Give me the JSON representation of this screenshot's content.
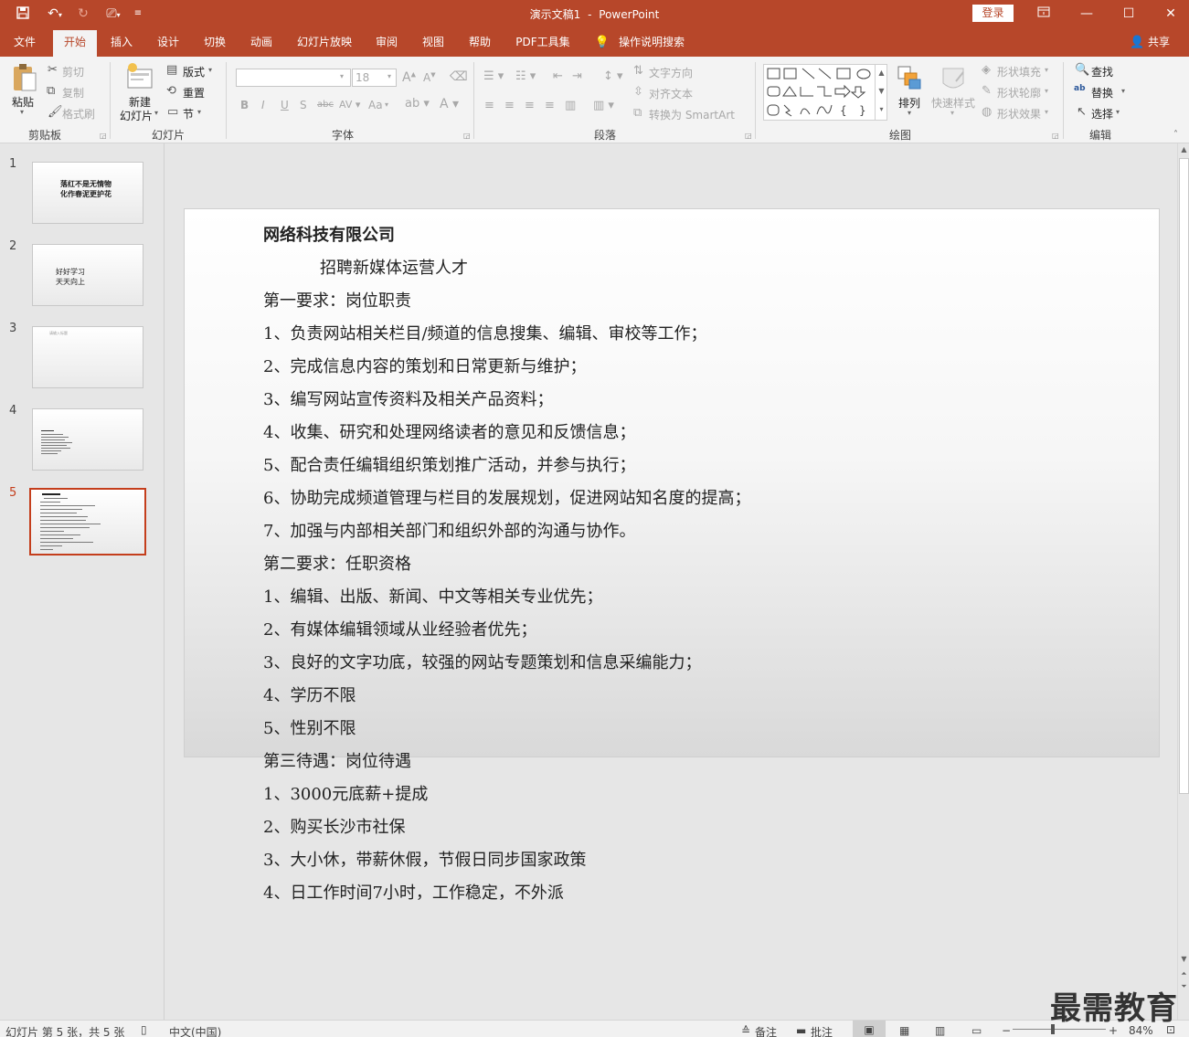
{
  "titlebar": {
    "doc_title": "演示文稿1",
    "separator": "-",
    "app_name": "PowerPoint",
    "login": "登录"
  },
  "tabs": [
    "文件",
    "开始",
    "插入",
    "设计",
    "切换",
    "动画",
    "幻灯片放映",
    "审阅",
    "视图",
    "帮助",
    "PDF工具集",
    "操作说明搜索"
  ],
  "share": "共享",
  "ribbon": {
    "clipboard": {
      "paste": "粘贴",
      "cut": "剪切",
      "copy": "复制",
      "format_painter": "格式刷",
      "group": "剪贴板"
    },
    "slides": {
      "new_slide_l1": "新建",
      "new_slide_l2": "幻灯片",
      "layout": "版式",
      "reset": "重置",
      "section": "节",
      "group": "幻灯片"
    },
    "font": {
      "size": "18",
      "bold": "B",
      "italic": "I",
      "underline": "U",
      "shadow": "S",
      "strike": "abc",
      "case": "Aa",
      "group": "字体"
    },
    "paragraph": {
      "text_direction": "文字方向",
      "align_text": "对齐文本",
      "smartart": "转换为 SmartArt",
      "group": "段落"
    },
    "drawing": {
      "arrange": "排列",
      "quick_styles": "快速样式",
      "fill": "形状填充",
      "outline": "形状轮廓",
      "effects": "形状效果",
      "group": "绘图"
    },
    "editing": {
      "find": "查找",
      "replace": "替换",
      "select": "选择",
      "group": "编辑"
    }
  },
  "slides": [
    {
      "num": "1",
      "lines": [
        "落红不是无情物",
        "化作春泥更护花"
      ]
    },
    {
      "num": "2",
      "lines": [
        "好好学习",
        "天天向上"
      ]
    },
    {
      "num": "3",
      "lines": [
        "请输入标题"
      ]
    },
    {
      "num": "4",
      "lines": []
    },
    {
      "num": "5",
      "lines": []
    }
  ],
  "content": {
    "company": "网络科技有限公司",
    "subtitle": "招聘新媒体运营人才",
    "lines": [
      "第一要求：岗位职责",
      "1、负责网站相关栏目/频道的信息搜集、编辑、审校等工作；",
      "2、完成信息内容的策划和日常更新与维护；",
      "3、编写网站宣传资料及相关产品资料；",
      "4、收集、研究和处理网络读者的意见和反馈信息；",
      "5、配合责任编辑组织策划推广活动，并参与执行；",
      "6、协助完成频道管理与栏目的发展规划，促进网站知名度的提高；",
      "7、加强与内部相关部门和组织外部的沟通与协作。",
      "第二要求：任职资格",
      "1、编辑、出版、新闻、中文等相关专业优先；",
      "2、有媒体编辑领域从业经验者优先；",
      "3、良好的文字功底，较强的网站专题策划和信息采编能力；",
      "4、学历不限",
      "5、性别不限",
      "第三待遇：岗位待遇",
      "1、3000元底薪+提成",
      "2、购买长沙市社保",
      "3、大小休，带薪休假，节假日同步国家政策",
      "4、日工作时间7小时，工作稳定，不外派"
    ]
  },
  "status": {
    "slide_info": "幻灯片 第 5 张，共 5 张",
    "language": "中文(中国)",
    "notes": "备注",
    "comments": "批注",
    "zoom": "84%"
  },
  "watermark": "最需教育"
}
